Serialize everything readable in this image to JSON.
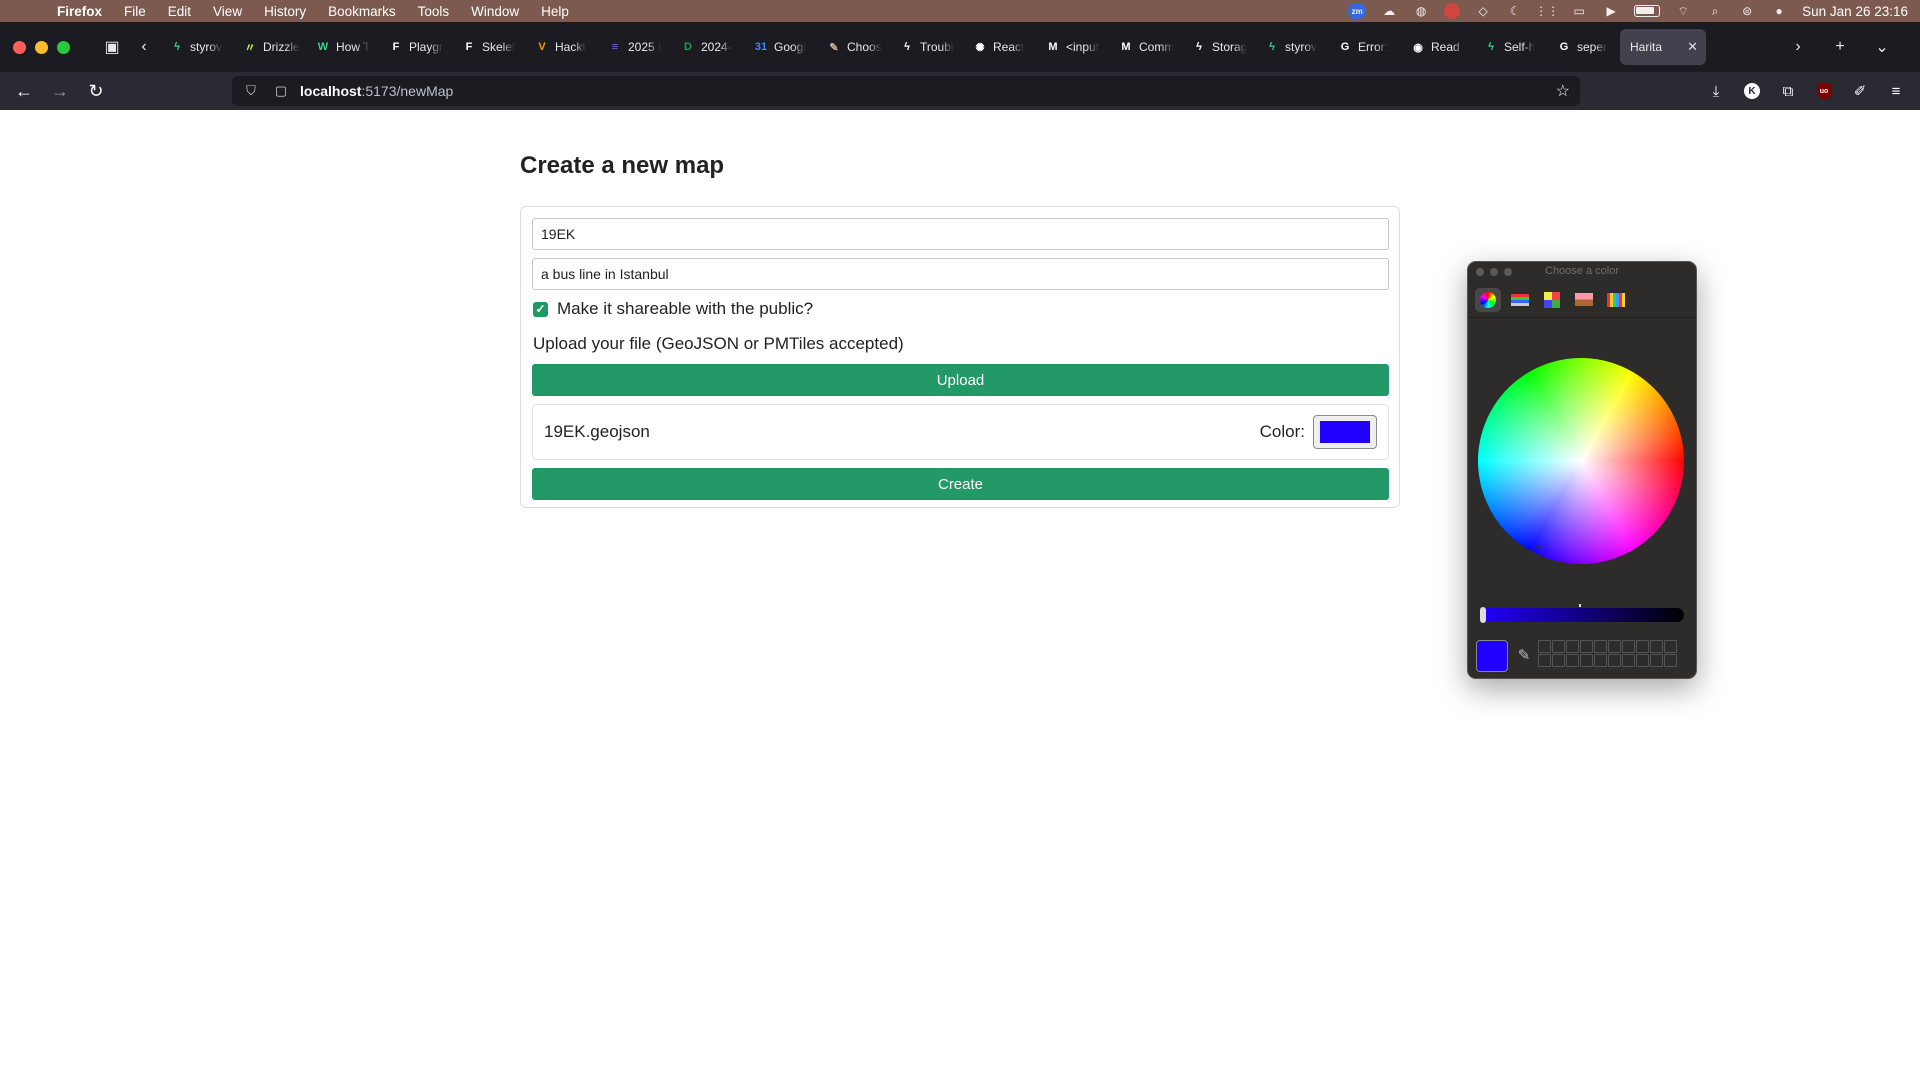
{
  "menubar": {
    "app": "Firefox",
    "items": [
      "File",
      "Edit",
      "View",
      "History",
      "Bookmarks",
      "Tools",
      "Window",
      "Help"
    ],
    "clock": "Sun Jan 26  23:16",
    "zoom_badge": "zm"
  },
  "tabs": [
    {
      "title": "styrov",
      "icon": "bolt-icon",
      "color": "#3ecf8e",
      "glyph": "ϟ"
    },
    {
      "title": "Drizzle",
      "icon": "drizzle-icon",
      "color": "#c5f74f",
      "glyph": "〃"
    },
    {
      "title": "How T",
      "icon": "w-icon",
      "color": "#3ecf8e",
      "glyph": "W"
    },
    {
      "title": "Playgr",
      "icon": "figma-icon",
      "color": "#ffffff",
      "glyph": "F"
    },
    {
      "title": "Skelet",
      "icon": "figma-icon",
      "color": "#ffffff",
      "glyph": "F"
    },
    {
      "title": "Hackt",
      "icon": "v-icon",
      "color": "#f59e0b",
      "glyph": "V"
    },
    {
      "title": "2025 I",
      "icon": "list-icon",
      "color": "#7c6cf0",
      "glyph": "≡"
    },
    {
      "title": "2024-",
      "icon": "d-icon",
      "color": "#1f9d55",
      "glyph": "D"
    },
    {
      "title": "Googl",
      "icon": "calendar-icon",
      "color": "#4285f4",
      "glyph": "31"
    },
    {
      "title": "Choos",
      "icon": "brush-icon",
      "color": "#c9b89a",
      "glyph": "✎"
    },
    {
      "title": "Troubl",
      "icon": "bolt-icon",
      "color": "#ffffff",
      "glyph": "ϟ"
    },
    {
      "title": "React",
      "icon": "openai-icon",
      "color": "#ffffff",
      "glyph": "✺"
    },
    {
      "title": "<input",
      "icon": "m-icon",
      "color": "#ffffff",
      "glyph": "M"
    },
    {
      "title": "Comm",
      "icon": "m-icon",
      "color": "#ffffff",
      "glyph": "M"
    },
    {
      "title": "Storag",
      "icon": "bolt-icon",
      "color": "#ffffff",
      "glyph": "ϟ"
    },
    {
      "title": "styrov",
      "icon": "bolt-icon",
      "color": "#3ecf8e",
      "glyph": "ϟ"
    },
    {
      "title": "Error:",
      "icon": "google-icon",
      "color": "#ffffff",
      "glyph": "G"
    },
    {
      "title": "Read :",
      "icon": "eye-icon",
      "color": "#ffffff",
      "glyph": "◉"
    },
    {
      "title": "Self-h",
      "icon": "bolt-icon",
      "color": "#3ecf8e",
      "glyph": "ϟ"
    },
    {
      "title": "seper",
      "icon": "google-icon",
      "color": "#ffffff",
      "glyph": "G"
    }
  ],
  "active_tab": {
    "title": "Harita"
  },
  "url": {
    "host": "localhost",
    "path": ":5173/newMap"
  },
  "page": {
    "title": "Create a new map",
    "name_value": "19EK",
    "description_value": "a bus line in Istanbul",
    "public_label": "Make it shareable with the public?",
    "public_checked": true,
    "upload_prompt": "Upload your file (GeoJSON or PMTiles accepted)",
    "upload_button": "Upload",
    "file_name": "19EK.geojson",
    "color_label": "Color:",
    "selected_color": "#2200ff",
    "create_button": "Create"
  },
  "color_picker": {
    "title": "Choose a color",
    "current_color": "#2200ff",
    "modes": [
      "color-wheel-icon",
      "sliders-icon",
      "palettes-icon",
      "image-palette-icon",
      "crayons-icon"
    ]
  }
}
